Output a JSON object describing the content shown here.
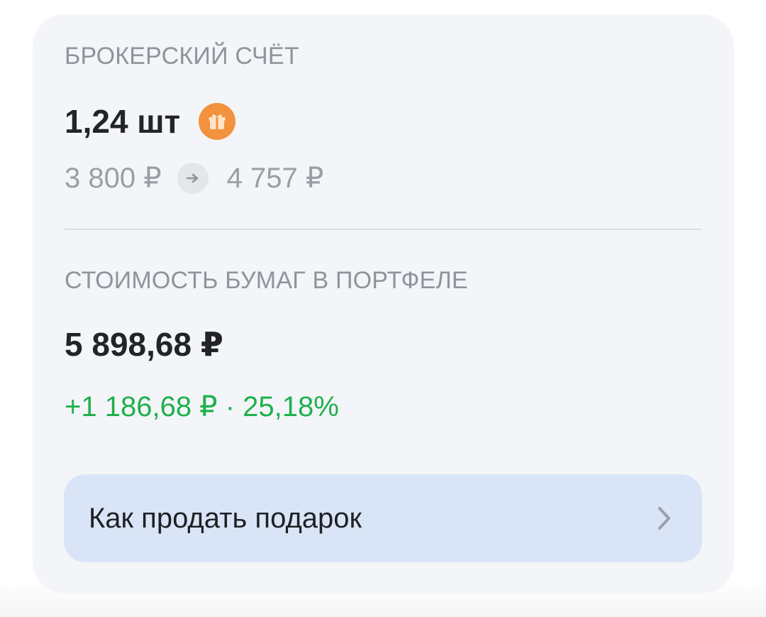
{
  "broker": {
    "section_label": "БРОКЕРСКИЙ СЧЁТ",
    "quantity": "1,24 шт",
    "gift_icon": "gift-icon",
    "price_from": "3 800 ₽",
    "price_to": "4 757 ₽",
    "arrow_icon": "arrow-right-icon"
  },
  "portfolio": {
    "section_label": "СТОИМОСТЬ БУМАГ В ПОРТФЕЛЕ",
    "total_value": "5 898,68 ₽",
    "change": "+1 186,68 ₽ · 25,18%",
    "change_color": "#1fb04c"
  },
  "sell_button": {
    "label": "Как продать подарок",
    "icon": "chevron-right-icon"
  },
  "colors": {
    "card_background": "#f3f5f8",
    "button_background": "#d9e5f7",
    "gift_badge": "#f2923f",
    "muted_text": "#8f949c"
  }
}
